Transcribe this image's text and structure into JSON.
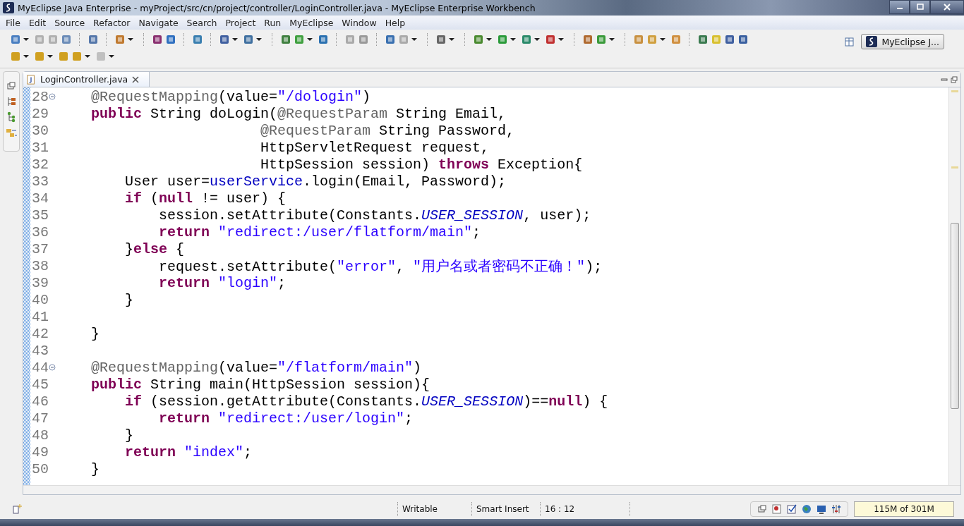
{
  "window": {
    "title": "MyEclipse Java Enterprise - myProject/src/cn/project/controller/LoginController.java - MyEclipse Enterprise Workbench"
  },
  "menu": [
    "File",
    "Edit",
    "Source",
    "Refactor",
    "Navigate",
    "Search",
    "Project",
    "Run",
    "MyEclipse",
    "Window",
    "Help"
  ],
  "perspective": {
    "label": "MyEclipse J...",
    "selected": true
  },
  "editor_tabs": [
    {
      "label": "LoginController.java",
      "selected": true
    }
  ],
  "code_lines": [
    {
      "number": "28",
      "fold": true,
      "tokens": [
        {
          "kind": "annotation",
          "text": "    @RequestMapping"
        },
        {
          "kind": "plain",
          "text": "(value="
        },
        {
          "kind": "string",
          "text": "\"/dologin\""
        },
        {
          "kind": "plain",
          "text": ")"
        }
      ]
    },
    {
      "number": "29",
      "fold": false,
      "tokens": [
        {
          "kind": "keyword",
          "text": "    public"
        },
        {
          "kind": "plain",
          "text": " String doLogin("
        },
        {
          "kind": "annotation",
          "text": "@RequestParam"
        },
        {
          "kind": "plain",
          "text": " String Email,"
        }
      ]
    },
    {
      "number": "30",
      "fold": false,
      "tokens": [
        {
          "kind": "annotation",
          "text": "                        @RequestParam"
        },
        {
          "kind": "plain",
          "text": " String Password,"
        }
      ]
    },
    {
      "number": "31",
      "fold": false,
      "tokens": [
        {
          "kind": "plain",
          "text": "                        HttpServletRequest request,"
        }
      ]
    },
    {
      "number": "32",
      "fold": false,
      "tokens": [
        {
          "kind": "plain",
          "text": "                        HttpSession session) "
        },
        {
          "kind": "keyword",
          "text": "throws"
        },
        {
          "kind": "plain",
          "text": " Exception{"
        }
      ]
    },
    {
      "number": "33",
      "fold": false,
      "tokens": [
        {
          "kind": "plain",
          "text": "        User user="
        },
        {
          "kind": "field",
          "text": "userService"
        },
        {
          "kind": "plain",
          "text": ".login(Email, Password);"
        }
      ]
    },
    {
      "number": "34",
      "fold": false,
      "tokens": [
        {
          "kind": "keyword",
          "text": "        if"
        },
        {
          "kind": "plain",
          "text": " ("
        },
        {
          "kind": "keyword",
          "text": "null"
        },
        {
          "kind": "plain",
          "text": " != user) {"
        }
      ]
    },
    {
      "number": "35",
      "fold": false,
      "tokens": [
        {
          "kind": "plain",
          "text": "            session.setAttribute(Constants."
        },
        {
          "kind": "static",
          "text": "USER_SESSION"
        },
        {
          "kind": "plain",
          "text": ", user);"
        }
      ]
    },
    {
      "number": "36",
      "fold": false,
      "tokens": [
        {
          "kind": "keyword",
          "text": "            return"
        },
        {
          "kind": "string",
          "text": " \"redirect:/user/flatform/main\""
        },
        {
          "kind": "plain",
          "text": ";"
        }
      ]
    },
    {
      "number": "37",
      "fold": false,
      "tokens": [
        {
          "kind": "plain",
          "text": "        }"
        },
        {
          "kind": "keyword",
          "text": "else"
        },
        {
          "kind": "plain",
          "text": " {"
        }
      ]
    },
    {
      "number": "38",
      "fold": false,
      "tokens": [
        {
          "kind": "plain",
          "text": "            request.setAttribute("
        },
        {
          "kind": "string",
          "text": "\"error\""
        },
        {
          "kind": "plain",
          "text": ", "
        },
        {
          "kind": "string",
          "text": "\"用户名或者密码不正确！\""
        },
        {
          "kind": "plain",
          "text": ");"
        }
      ]
    },
    {
      "number": "39",
      "fold": false,
      "tokens": [
        {
          "kind": "keyword",
          "text": "            return"
        },
        {
          "kind": "string",
          "text": " \"login\""
        },
        {
          "kind": "plain",
          "text": ";"
        }
      ]
    },
    {
      "number": "40",
      "fold": false,
      "tokens": [
        {
          "kind": "plain",
          "text": "        }"
        }
      ]
    },
    {
      "number": "41",
      "fold": false
    },
    {
      "number": "42",
      "fold": false,
      "tokens": [
        {
          "kind": "plain",
          "text": "    }"
        }
      ]
    },
    {
      "number": "43",
      "fold": false
    },
    {
      "number": "44",
      "fold": true,
      "tokens": [
        {
          "kind": "annotation",
          "text": "    @RequestMapping"
        },
        {
          "kind": "plain",
          "text": "(value="
        },
        {
          "kind": "string",
          "text": "\"/flatform/main\""
        },
        {
          "kind": "plain",
          "text": ")"
        }
      ]
    },
    {
      "number": "45",
      "fold": false,
      "tokens": [
        {
          "kind": "keyword",
          "text": "    public"
        },
        {
          "kind": "plain",
          "text": " String main(HttpSession session){"
        }
      ]
    },
    {
      "number": "46",
      "fold": false,
      "tokens": [
        {
          "kind": "keyword",
          "text": "        if"
        },
        {
          "kind": "plain",
          "text": " (session.getAttribute(Constants."
        },
        {
          "kind": "static",
          "text": "USER_SESSION"
        },
        {
          "kind": "plain",
          "text": ")=="
        },
        {
          "kind": "keyword",
          "text": "null"
        },
        {
          "kind": "plain",
          "text": ") {"
        }
      ]
    },
    {
      "number": "47",
      "fold": false,
      "tokens": [
        {
          "kind": "keyword",
          "text": "            return"
        },
        {
          "kind": "string",
          "text": " \"redirect:/user/login\""
        },
        {
          "kind": "plain",
          "text": ";"
        }
      ]
    },
    {
      "number": "48",
      "fold": false,
      "tokens": [
        {
          "kind": "plain",
          "text": "        }"
        }
      ]
    },
    {
      "number": "49",
      "fold": false,
      "tokens": [
        {
          "kind": "keyword",
          "text": "        return"
        },
        {
          "kind": "string",
          "text": " \"index\""
        },
        {
          "kind": "plain",
          "text": ";"
        }
      ]
    },
    {
      "number": "50",
      "fold": false,
      "tokens": [
        {
          "kind": "plain",
          "text": "    }"
        }
      ]
    }
  ],
  "status_bar": {
    "mode": "Writable",
    "insert": "Smart Insert",
    "position": "16 : 12",
    "heap": "115M of 301M"
  }
}
